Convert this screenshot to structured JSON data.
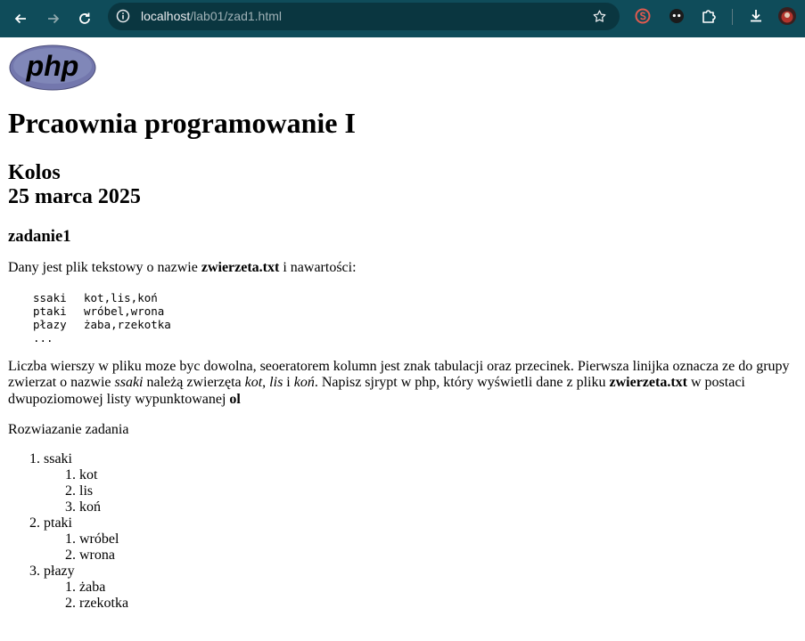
{
  "browser": {
    "url_host": "localhost",
    "url_path": "/lab01/zad1.html"
  },
  "page": {
    "logo_text": "php",
    "title": "Prcaownia programowanie I",
    "subtitle_line1": "Kolos",
    "subtitle_line2": "25 marca 2025",
    "task_heading": "zadanie1",
    "intro_prefix": "Dany jest plik tekstowy o nazwie ",
    "intro_file": "zwierzeta.txt",
    "intro_suffix": " i nawartości:",
    "file_rows": [
      {
        "key": "ssaki",
        "val": "kot,lis,koń"
      },
      {
        "key": "ptaki",
        "val": "wróbel,wrona"
      },
      {
        "key": "płazy",
        "val": "żaba,rzekotka"
      }
    ],
    "file_ellipsis": "...",
    "desc_1": "Liczba wierszy w pliku moze byc dowolna, seoeratorem kolumn jest znak tabulacji oraz przecinek. Pierwsza linijka oznacza ze do grupy zwierzat o nazwie ",
    "desc_ssaki": "ssaki",
    "desc_2": " należą zwierzęta ",
    "desc_kot": "kot",
    "desc_3": ", ",
    "desc_lis": "lis",
    "desc_4": " i ",
    "desc_kon": "koń",
    "desc_5": ". Napisz sjrypt w php, który wyświetli dane z pliku ",
    "desc_file": "zwierzeta.txt",
    "desc_6": " w postaci dwupoziomowej listy wypunktowanej ",
    "desc_ol": "ol",
    "solution_label": "Rozwiazanie zadania",
    "solution": [
      {
        "group": "ssaki",
        "items": [
          "kot",
          "lis",
          "koń"
        ]
      },
      {
        "group": "ptaki",
        "items": [
          "wróbel",
          "wrona"
        ]
      },
      {
        "group": "płazy",
        "items": [
          "żaba",
          "rzekotka"
        ]
      }
    ]
  }
}
